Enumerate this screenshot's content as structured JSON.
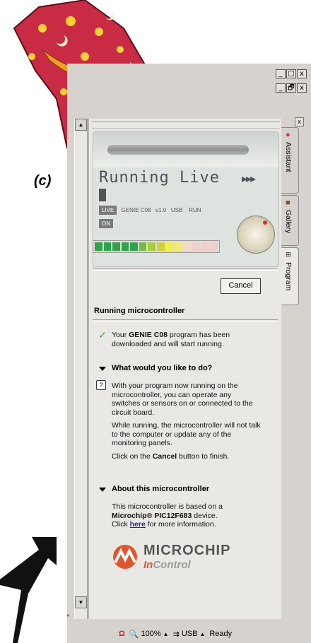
{
  "side_label": "(c)",
  "window": {
    "buttons_top": [
      "_",
      "□",
      "x"
    ],
    "buttons_mid": [
      "_",
      "🗗",
      "x"
    ]
  },
  "tabs": [
    {
      "label": "Assistant",
      "icon": "tomato-icon"
    },
    {
      "label": "Gallery",
      "icon": "folder-icon"
    },
    {
      "label": "Program",
      "icon": "network-icon"
    }
  ],
  "lcd": {
    "title": "Running Live",
    "arrows": "▸▸▸",
    "live": "LIVE",
    "on": "ON",
    "device": "GENIE C08",
    "version": "v1.0",
    "connection": "USB",
    "state": "RUN",
    "meter_colors": [
      "#2fa34a",
      "#2fa34a",
      "#2fa34a",
      "#2fa34a",
      "#2fa34a",
      "#6dbf3e",
      "#a8cf3a",
      "#cfd23a",
      "#f2ec55",
      "#f3ec6a",
      "#f5d7cc",
      "#f2d0c8",
      "#efcfc6",
      "#eecfc6"
    ]
  },
  "cancel_label": "Cancel",
  "section_title": "Running microcontroller",
  "downloaded": {
    "prefix": "Your ",
    "bold": "GENIE C08",
    "suffix": " program has been downloaded and will start running."
  },
  "what_title": "What would you like to do?",
  "what_p1": "With your program now running on the microcontroller, you can operate any switches or sensors on or connected to the circuit board.",
  "what_p2": "While running, the microcontroller will not talk to the computer or update any of the monitoring panels.",
  "what_p3": {
    "prefix": "Click on the ",
    "bold": "Cancel",
    "suffix": " button to finish."
  },
  "about_title": "About this microcontroller",
  "about_p1": {
    "prefix": "This microcontroller is based on a ",
    "bold": "Microchip® PIC12F683",
    "suffix": " device."
  },
  "about_p2": {
    "prefix": "Click ",
    "link": "here",
    "suffix": " for more information."
  },
  "brand": {
    "name": "MICROCHIP",
    "sub_in": "In",
    "sub_control": "Control"
  },
  "status": {
    "zoom": "100%",
    "connection": "USB",
    "state": "Ready"
  }
}
